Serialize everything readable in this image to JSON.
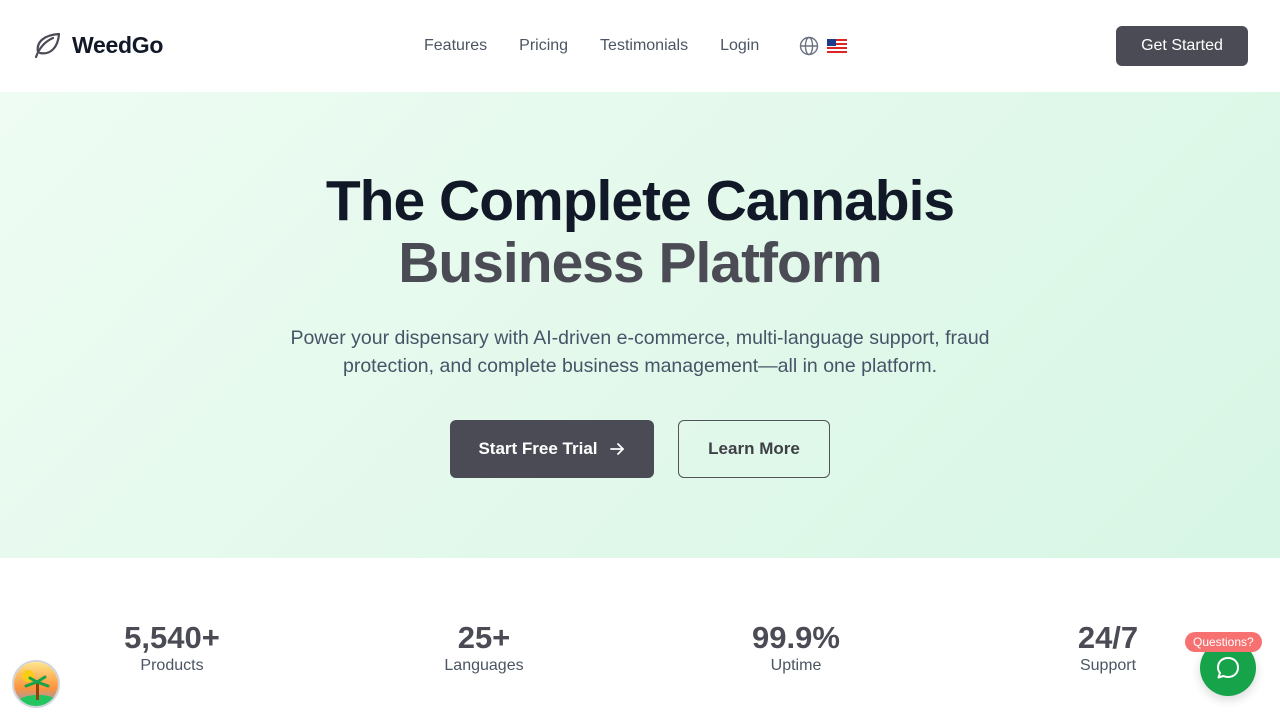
{
  "brand": {
    "name": "WeedGo",
    "icon": "leaf-icon"
  },
  "nav": {
    "items": [
      "Features",
      "Pricing",
      "Testimonials",
      "Login"
    ],
    "language_icon": "globe-icon",
    "flag": "🇺🇸"
  },
  "header_cta": "Get Started",
  "hero": {
    "title_line1": "The Complete Cannabis",
    "title_line2": "Business Platform",
    "subtitle": "Power your dispensary with AI-driven e-commerce, multi-language support, fraud protection, and complete business management—all in one platform.",
    "primary_button": "Start Free Trial",
    "secondary_button": "Learn More"
  },
  "stats": [
    {
      "value": "5,540+",
      "label": "Products"
    },
    {
      "value": "25+",
      "label": "Languages"
    },
    {
      "value": "99.9%",
      "label": "Uptime"
    },
    {
      "value": "24/7",
      "label": "Support"
    }
  ],
  "chat": {
    "badge": "Questions?",
    "icon": "chat-bubble-icon"
  },
  "colors": {
    "accent_dark": "#4b4b55",
    "hero_bg": "#e4f9ec",
    "chat_green": "#16a34a",
    "badge_red": "#f87171"
  }
}
